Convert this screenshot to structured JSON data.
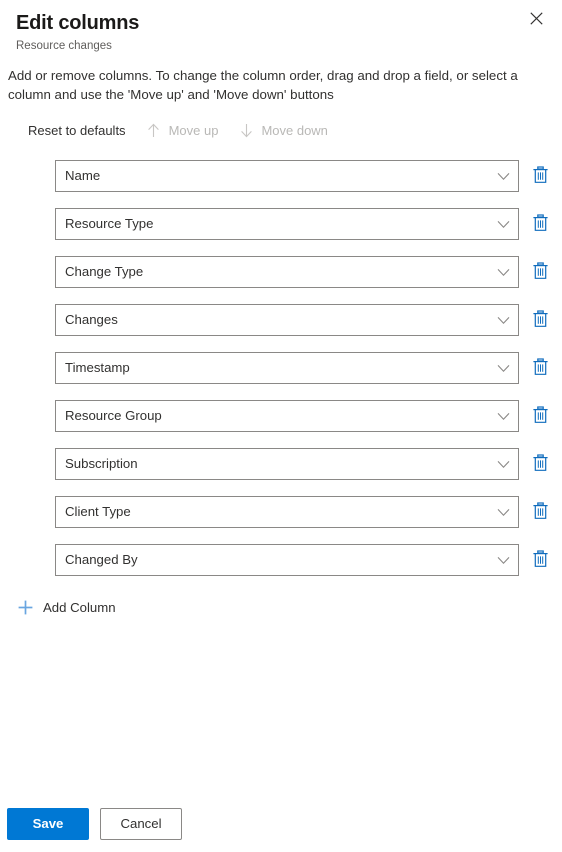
{
  "panel": {
    "title": "Edit columns",
    "subtitle": "Resource changes",
    "close_icon": "close-icon",
    "description": "Add or remove columns. To change the column order, drag and drop a field, or select a column and use the 'Move up' and 'Move down' buttons"
  },
  "command_bar": {
    "reset_label": "Reset to defaults",
    "move_up_label": "Move up",
    "move_up_icon": "arrow-up-icon",
    "move_up_disabled": true,
    "move_down_label": "Move down",
    "move_down_icon": "arrow-down-icon",
    "move_down_disabled": true
  },
  "columns": [
    {
      "label": "Name"
    },
    {
      "label": "Resource Type"
    },
    {
      "label": "Change Type"
    },
    {
      "label": "Changes"
    },
    {
      "label": "Timestamp"
    },
    {
      "label": "Resource Group"
    },
    {
      "label": "Subscription"
    },
    {
      "label": "Client Type"
    },
    {
      "label": "Changed By"
    }
  ],
  "row_icons": {
    "chevron": "chevron-down-icon",
    "delete": "trash-icon"
  },
  "add_column": {
    "label": "Add Column",
    "icon": "plus-icon"
  },
  "footer": {
    "save_label": "Save",
    "cancel_label": "Cancel"
  },
  "colors": {
    "accent": "#0078d4",
    "delete_icon": "#0f6cbd",
    "plus_icon": "#69a5e0",
    "text": "#323130",
    "subtle_text": "#605e5c",
    "disabled_text": "#b9b8b6",
    "border": "#8a8886"
  }
}
